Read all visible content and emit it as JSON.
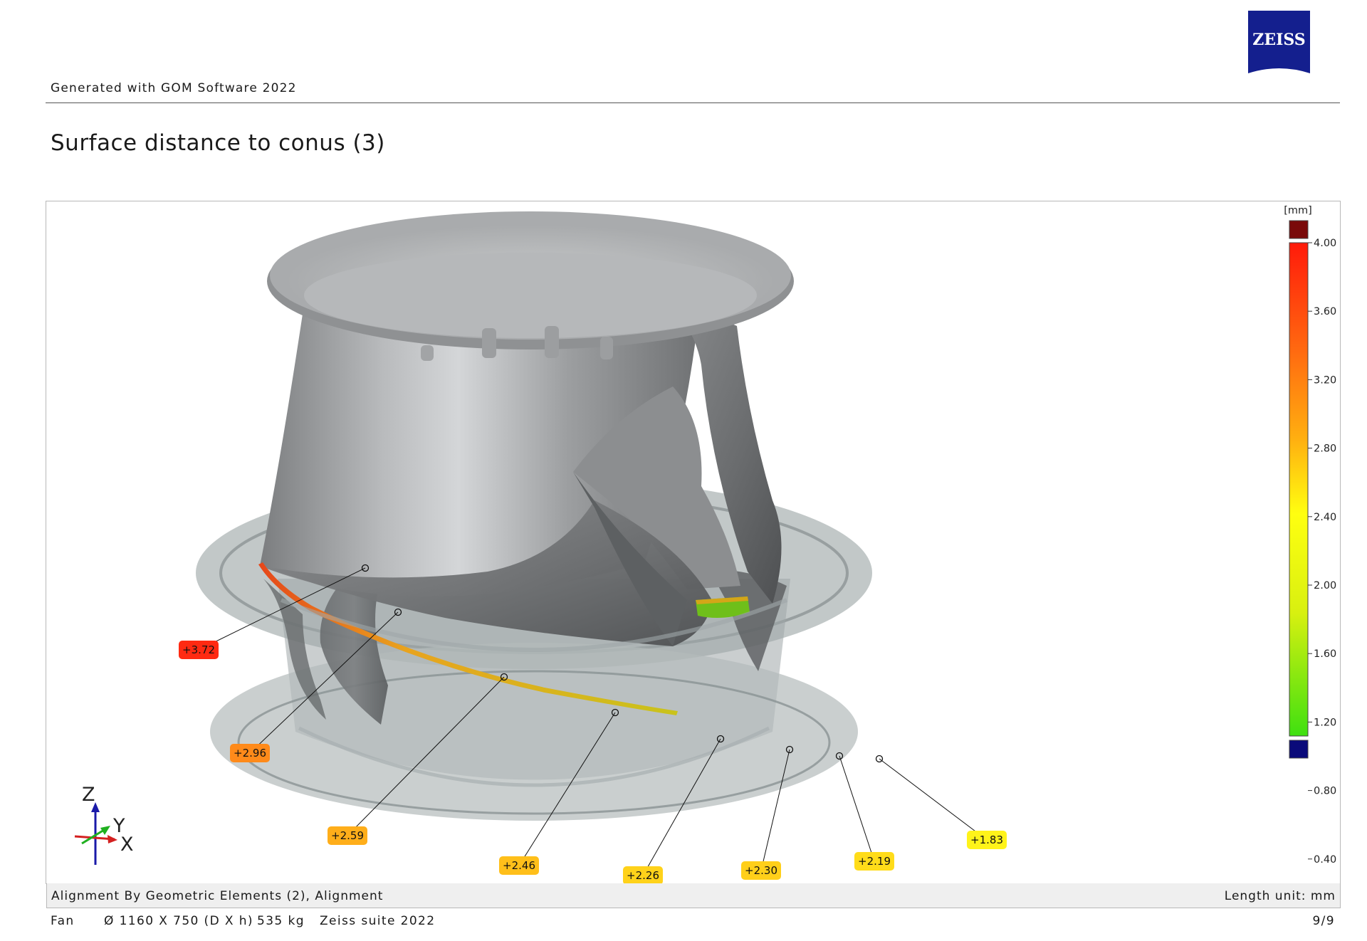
{
  "header": {
    "generated_text": "Generated with GOM Software 2022",
    "logo_text": "ZEISS"
  },
  "title": "Surface distance to conus (3)",
  "viewer": {
    "axis_triad": {
      "z": "Z",
      "y": "Y",
      "x": "X"
    },
    "deviation_labels": [
      {
        "value": "+3.72",
        "color": "#ff2a12"
      },
      {
        "value": "+2.96",
        "color": "#ff8a1a"
      },
      {
        "value": "+2.59",
        "color": "#ffae1a"
      },
      {
        "value": "+2.46",
        "color": "#ffbf1a"
      },
      {
        "value": "+2.26",
        "color": "#ffd21a"
      },
      {
        "value": "+2.30",
        "color": "#ffcf1a"
      },
      {
        "value": "+2.19",
        "color": "#ffdc1a"
      },
      {
        "value": "+1.83",
        "color": "#fff31a"
      }
    ],
    "color_scale": {
      "unit": "[mm]",
      "ticks": [
        "4.00",
        "3.60",
        "3.20",
        "2.80",
        "2.40",
        "2.00",
        "1.60",
        "1.20",
        "0.80",
        "0.40"
      ],
      "overflow_color": "#7a0a0a",
      "underflow_color": "#0a0a7a"
    }
  },
  "status_bar": {
    "alignment": "Alignment By Geometric Elements (2), Alignment",
    "length_unit": "Length unit: mm"
  },
  "footer": {
    "name": "Fan",
    "dimensions": "Ø 1160 X 750 (D X h)",
    "weight": "535 kg",
    "suite": "Zeiss suite 2022",
    "page": "9/9"
  }
}
